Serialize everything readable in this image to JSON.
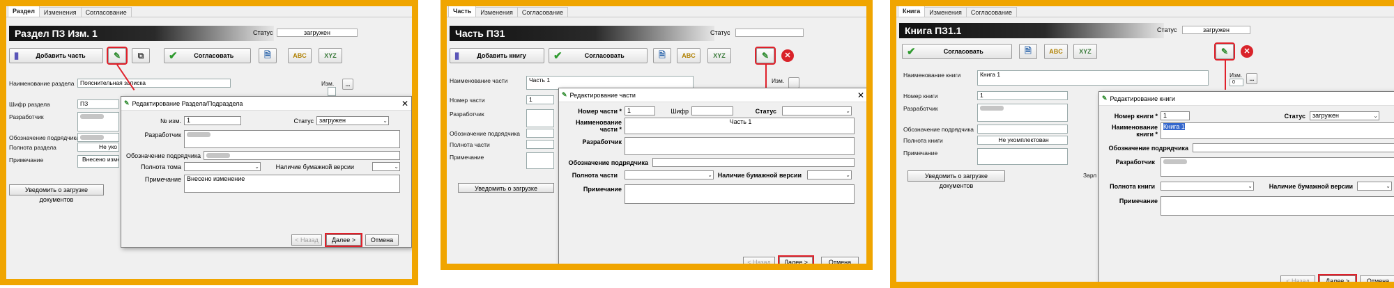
{
  "panel1": {
    "tabs": [
      "Раздел",
      "Изменения",
      "Согласование"
    ],
    "title": "Раздел  ПЗ Изм. 1",
    "status_label": "Статус",
    "status_value": "загружен",
    "add_button": "Добавить часть",
    "approve_button": "Согласовать",
    "fields": [
      {
        "label": "Наименование раздела",
        "value": "Пояснительная записка"
      },
      {
        "label": "Шифр раздела",
        "value": "ПЗ"
      },
      {
        "label": "Разработчик",
        "value": ""
      },
      {
        "label": "Обозначение подрядчика",
        "value": ""
      },
      {
        "label": "Полнота раздела",
        "value": "Не уко"
      },
      {
        "label": "Примечание",
        "value": "Внесено изменени"
      }
    ],
    "izm_label": "Изм.",
    "notify_button": "Уведомить о загрузке документов",
    "dialog": {
      "title": "Редактирование Раздела/Подраздела",
      "izm_label": "№ изм.",
      "izm_value": "1",
      "status_label": "Статус",
      "status_value": "загружен",
      "developer_label": "Разработчик",
      "contractor_label": "Обозначение подрядчика",
      "completeness_label": "Полнота тома",
      "paper_label": "Наличие бумажной версии",
      "note_label": "Примечание",
      "note_value": "Внесено изменение",
      "back": "< Назад",
      "next": "Далее >",
      "cancel": "Отмена"
    }
  },
  "panel2": {
    "tabs": [
      "Часть",
      "Изменения",
      "Согласование"
    ],
    "title": "Часть ПЗ1",
    "status_label": "Статус",
    "add_button": "Добавить книгу",
    "approve_button": "Согласовать",
    "fields": [
      {
        "label": "Наименование части",
        "value": "Часть 1"
      },
      {
        "label": "Номер части",
        "value": "1"
      },
      {
        "label": "Разработчик",
        "value": ""
      },
      {
        "label": "Обозначение подрядчика",
        "value": ""
      },
      {
        "label": "Полнота части",
        "value": ""
      },
      {
        "label": "Примечание",
        "value": ""
      }
    ],
    "izm_label": "Изм.",
    "notify_button": "Уведомить о загрузке документов",
    "dialog": {
      "title": "Редактирование части",
      "number_label": "Номер части *",
      "number_value": "1",
      "cipher_label": "Шифр",
      "status_label": "Статус",
      "name_label": "Наименование части *",
      "name_value": "Часть 1",
      "developer_label": "Разработчик",
      "contractor_label": "Обозначение подрядчика",
      "completeness_label": "Полнота части",
      "paper_label": "Наличие бумажной версии",
      "note_label": "Примечание",
      "back": "< Назад",
      "next": "Далее >",
      "cancel": "Отмена"
    }
  },
  "panel3": {
    "tabs": [
      "Книга",
      "Изменения",
      "Согласование"
    ],
    "title": "Книга ПЗ1.1",
    "status_label": "Статус",
    "status_value": "загружен",
    "approve_button": "Согласовать",
    "fields": [
      {
        "label": "Наименование книги",
        "value": "Книга 1"
      },
      {
        "label": "Номер книги",
        "value": "1"
      },
      {
        "label": "Разработчик",
        "value": ""
      },
      {
        "label": "Обозначение подрядчика",
        "value": ""
      },
      {
        "label": "Полнота книги",
        "value": "Не укомплектован"
      },
      {
        "label": "Примечание",
        "value": ""
      }
    ],
    "izm_label": "Изм.",
    "izm_value": "0",
    "notify_button": "Уведомить о загрузке документов",
    "zarl_label": "Зарл",
    "dialog": {
      "title": "Редактирование книги",
      "number_label": "Номер книги *",
      "number_value": "1",
      "status_label": "Статус",
      "status_value": "загружен",
      "name_label": "Наименование книги *",
      "name_value": "Книга 1",
      "contractor_label": "Обозначение подрядчика",
      "developer_label": "Разработчик",
      "completeness_label": "Полнота книги",
      "paper_label": "Наличие бумажной версии",
      "note_label": "Примечание",
      "back": "< Назад",
      "next": "Далее >",
      "cancel": "Отмена"
    }
  },
  "colors": {
    "frame": "#f0a500",
    "highlight": "#e0202a",
    "green_check": "#2e9a2e"
  }
}
